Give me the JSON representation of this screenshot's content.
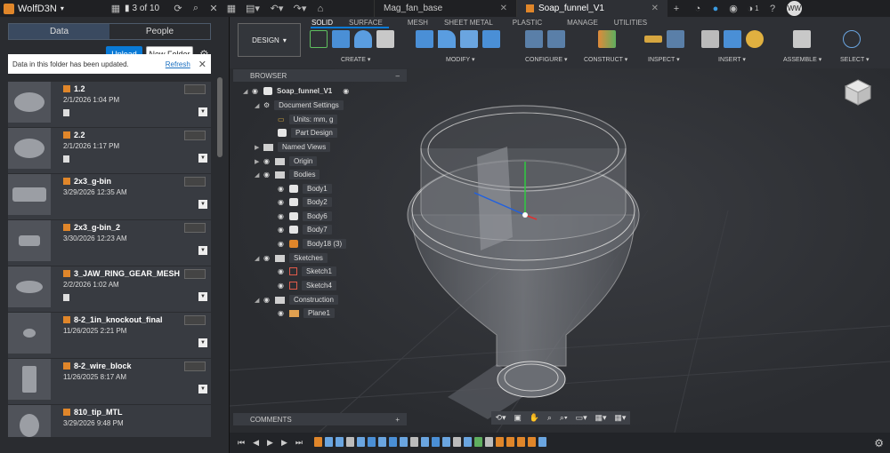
{
  "topbar": {
    "team": "WolfD3N",
    "counter": "3 of 10",
    "tabs": [
      {
        "label": "Mag_fan_base",
        "active": false
      },
      {
        "label": "Soap_funnel_V1",
        "active": true
      }
    ],
    "notifications": "1",
    "user_initials": "WW",
    "brand_color": "#e0862a"
  },
  "data_panel": {
    "tabs": [
      "Data",
      "People"
    ],
    "active_tab": "Data",
    "upload_label": "Upload",
    "new_folder_label": "New Folder",
    "notice_text": "Data in this folder has been updated.",
    "refresh_label": "Refresh",
    "files": [
      {
        "name": "1.2",
        "date": "2/1/2026 1:04 PM"
      },
      {
        "name": "2.2",
        "date": "2/1/2026 1:17 PM"
      },
      {
        "name": "2x3_g-bin",
        "date": "3/29/2026 12:35 AM"
      },
      {
        "name": "2x3_g-bin_2",
        "date": "3/30/2026 12:23 AM"
      },
      {
        "name": "3_JAW_RING_GEAR_MESH",
        "date": "2/2/2026 1:02 AM"
      },
      {
        "name": "8-2_1in_knockout_final",
        "date": "11/26/2025 2:21 PM"
      },
      {
        "name": "8-2_wire_block",
        "date": "11/26/2025 8:17 AM"
      },
      {
        "name": "810_tip_MTL",
        "date": "3/29/2026 9:48 PM"
      }
    ]
  },
  "toolbar": {
    "design_label": "DESIGN",
    "workspace_tabs": [
      "SOLID",
      "SURFACE",
      "MESH",
      "SHEET METAL",
      "PLASTIC",
      "MANAGE",
      "UTILITIES"
    ],
    "active_workspace": "SOLID",
    "groups": [
      "CREATE",
      "MODIFY",
      "CONFIGURE",
      "CONSTRUCT",
      "INSPECT",
      "INSERT",
      "ASSEMBLE",
      "SELECT"
    ]
  },
  "browser": {
    "title": "BROWSER",
    "root": "Soap_funnel_V1",
    "doc_settings": "Document Settings",
    "units": "Units: mm, g",
    "part_design": "Part Design",
    "named_views": "Named Views",
    "origin": "Origin",
    "bodies": "Bodies",
    "body_items": [
      "Body1",
      "Body2",
      "Body6",
      "Body7",
      "Body18 (3)"
    ],
    "sketches": "Sketches",
    "sketch_items": [
      "Sketch1",
      "Sketch4"
    ],
    "construction": "Construction",
    "construction_items": [
      "Plane1"
    ]
  },
  "comments_label": "COMMENTS"
}
